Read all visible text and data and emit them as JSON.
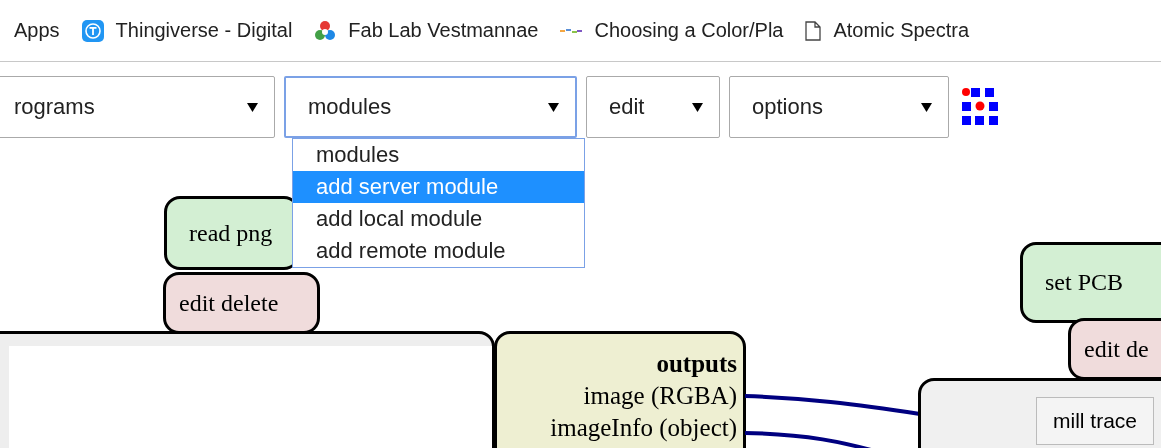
{
  "bookmarks": [
    {
      "label": "Apps",
      "kind": "apps"
    },
    {
      "label": "Thingiverse - Digital",
      "kind": "thingiverse"
    },
    {
      "label": "Fab Lab Vestmannae",
      "kind": "fablab"
    },
    {
      "label": "Choosing a Color/Pla",
      "kind": "palette"
    },
    {
      "label": "Atomic Spectra",
      "kind": "page"
    }
  ],
  "selects": [
    {
      "label": "rograms",
      "focused": false
    },
    {
      "label": "modules",
      "focused": true
    },
    {
      "label": "edit",
      "focused": false
    },
    {
      "label": "options",
      "focused": false
    }
  ],
  "dropdown": {
    "options": [
      {
        "label": "modules",
        "selected": false
      },
      {
        "label": "add server module",
        "selected": true
      },
      {
        "label": "add local module",
        "selected": false
      },
      {
        "label": "add remote module",
        "selected": false
      }
    ]
  },
  "nodes": [
    {
      "kind": "title",
      "label": "read png"
    },
    {
      "kind": "actions",
      "label": "edit delete"
    },
    {
      "kind": "title",
      "label": "set PCB"
    },
    {
      "kind": "actions",
      "label": "edit de"
    }
  ],
  "outputs": {
    "heading": "outputs",
    "items": [
      "image (RGBA)",
      "imageInfo (object)"
    ]
  },
  "right_panel": {
    "button": "mill trace"
  }
}
